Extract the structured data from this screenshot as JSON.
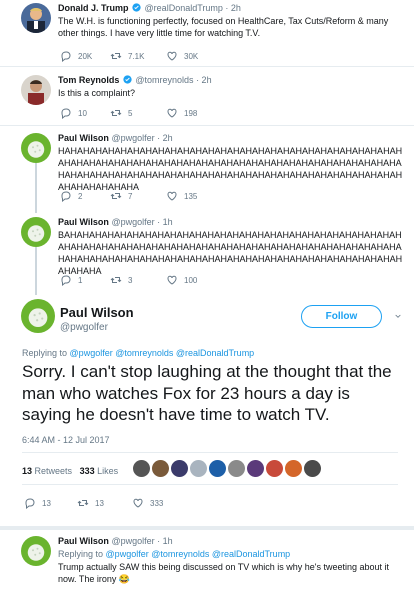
{
  "tweets": [
    {
      "name": "Donald J. Trump",
      "handle": "@realDonaldTrump",
      "time": "· 2h",
      "text": "The W.H. is functioning perfectly, focused on HealthCare, Tax Cuts/Reform & many other things. I have very little time for watching T.V.",
      "replies": "20K",
      "retweets": "7.1K",
      "likes": "30K"
    },
    {
      "name": "Tom Reynolds",
      "handle": "@tomreynolds",
      "time": "· 2h",
      "text": "Is this a complaint?",
      "replies": "10",
      "retweets": "5",
      "likes": "198"
    },
    {
      "name": "Paul Wilson",
      "handle": "@pwgolfer",
      "time": "· 2h",
      "text": "HAHAHAHAHAHAHAHAHAHAHAHAHAHAHAHAHAHAHAHAHAHAHAHAHAHAHAHAHAHAHAHAHAHAHAHAHAHAHAHAHAHAHAHAHAHAHAHAHAHAHAHAHAHAHAHAHAHAHAHAHAHAHAHAHAHAHAHAHAHAHAHAHAHAHAHAHAHAHAHAHAHAHAHAHAHAHAHAHA",
      "replies": "2",
      "retweets": "7",
      "likes": "135"
    },
    {
      "name": "Paul Wilson",
      "handle": "@pwgolfer",
      "time": "· 1h",
      "text": "BAHAHAHAHAHAHAHAHAHAHAHAHAHAHAHAHAHAHAHAHAHAHAHAHAHAHAHAHAHAHAHAHAHAHAHAHAHAHAHAHAHAHAHAHAHAHAHAHAHAHAHAHAHAHAHAHAHAHAHAHAHAHAHAHAHAHAHAHAHAHAHAHAHAHAHAHAHAHAHAHAHAHAHAHAHA",
      "replies": "1",
      "retweets": "3",
      "likes": "100"
    }
  ],
  "main": {
    "name": "Paul Wilson",
    "handle": "@pwgolfer",
    "follow_label": "Follow",
    "replying_prefix": "Replying to",
    "replying_to": "@pwgolfer @tomreynolds @realDonaldTrump",
    "text": "Sorry. I can't stop laughing at the thought that the man who watches Fox for 23 hours a day is saying he doesn't have time to watch TV.",
    "timestamp": "6:44 AM - 12 Jul 2017",
    "retweets_count": "13",
    "retweets_label": "Retweets",
    "likes_count": "333",
    "likes_label": "Likes",
    "replies": "13",
    "retweets": "13",
    "likes": "333"
  },
  "reply": {
    "name": "Paul Wilson",
    "handle": "@pwgolfer",
    "time": "· 1h",
    "replying_prefix": "Replying to",
    "replying_to": "@pwgolfer @tomreynolds @realDonaldTrump",
    "text": "Trump actually SAW this being discussed on TV which is why he's tweeting about it now. The irony 😂"
  },
  "colors": {
    "link": "#1b95e0",
    "muted": "#657786",
    "verified": "#1da1f2"
  },
  "icons": [
    "reply-icon",
    "retweet-icon",
    "like-icon",
    "verified-icon",
    "chevron-down-icon"
  ]
}
